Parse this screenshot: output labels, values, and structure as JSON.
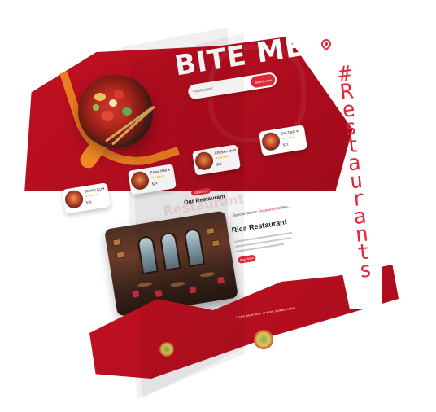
{
  "brochure": {
    "hero_title": "BITE ME !",
    "search": {
      "placeholder": "Restaurant",
      "button_label": "Search now"
    },
    "hashtag": "#\nR\ne\ns\nt\na\nu\nr\na\nn\nt\ns"
  },
  "dishes": [
    {
      "name": "Shrimp Cu",
      "stars": "★★★★★",
      "price": "$18"
    },
    {
      "name": "Pasta Hell",
      "stars": "★★★★★",
      "price": "$24"
    },
    {
      "name": "Chicken Dum",
      "stars": "★★★★★",
      "price": "$16"
    },
    {
      "name": "Dal Tadk",
      "stars": "★★★★★",
      "price": "$12"
    }
  ],
  "about": {
    "tag": "About Us",
    "background_word": "Restaurant",
    "title": "Our Restaurant",
    "kicker_prefix": "Special Classic ",
    "kicker_accent": "Restaurant",
    "kicker_suffix": " Coffee...",
    "restaurant_name": "Rica Restaurant",
    "button_label": "Read More"
  },
  "band": {
    "caption": "Lorem ipsum dolor sit amet, Vindaloo Indian"
  },
  "colors": {
    "brand_red": "#c21021",
    "accent_red": "#e0283a",
    "orange": "#f08a24",
    "star": "#f5b400"
  }
}
